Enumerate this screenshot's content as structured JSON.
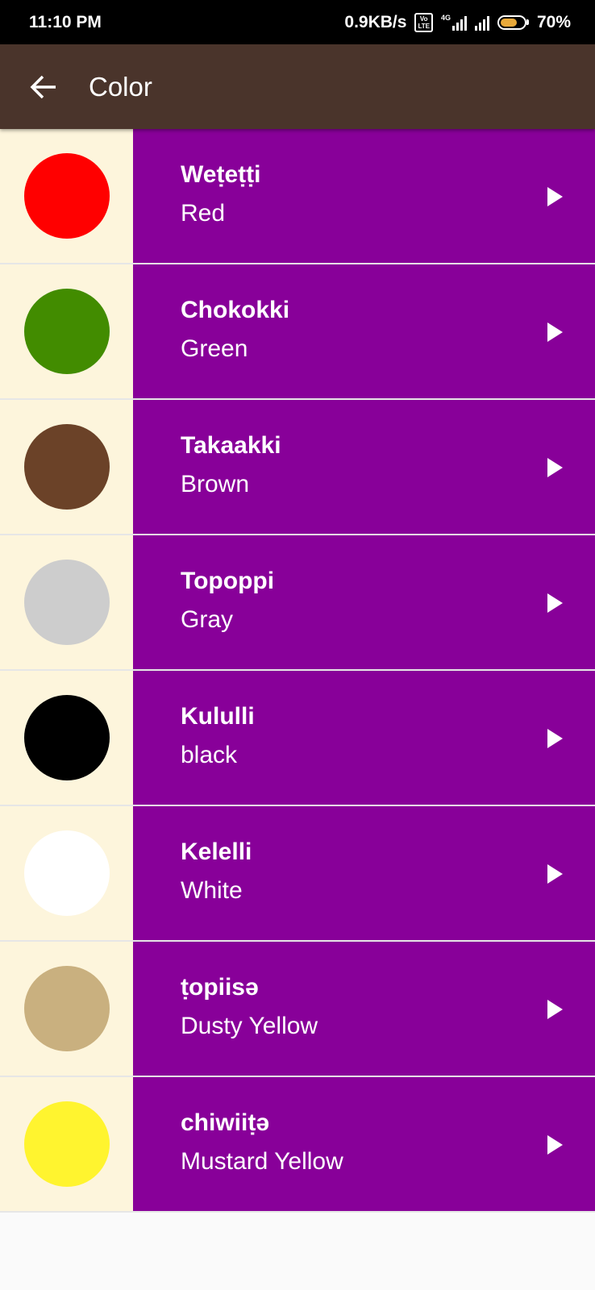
{
  "status_bar": {
    "time": "11:10 PM",
    "speed": "0.9KB/s",
    "volte": "Vo LTE",
    "network": "4G",
    "battery_percent": "70%",
    "battery_level": 0.7
  },
  "app_bar": {
    "back_icon": "arrow-left-icon",
    "title": "Color"
  },
  "colors": [
    {
      "native": "Weṭeṭṭi",
      "english": "Red",
      "swatch": "#ff0000"
    },
    {
      "native": "Chokokki",
      "english": "Green",
      "swatch": "#428c00"
    },
    {
      "native": "Takaakki",
      "english": "Brown",
      "swatch": "#6b4228"
    },
    {
      "native": "Topoppi",
      "english": "Gray",
      "swatch": "#cdcdcd"
    },
    {
      "native": "Kululli",
      "english": "black",
      "swatch": "#000000"
    },
    {
      "native": "Kelelli",
      "english": "White",
      "swatch": "#ffffff"
    },
    {
      "native": "ṭopiisə",
      "english": "Dusty Yellow",
      "swatch": "#c9b07f"
    },
    {
      "native": "chiwiiṭə",
      "english": "Mustard Yellow",
      "swatch": "#fff42f"
    }
  ],
  "theme": {
    "status_bar_bg": "#000000",
    "app_bar_bg": "#4a342b",
    "swatch_cell_bg": "#fdf5dc",
    "row_bg": "#880099",
    "chevron_icon": "play-arrow-icon"
  }
}
